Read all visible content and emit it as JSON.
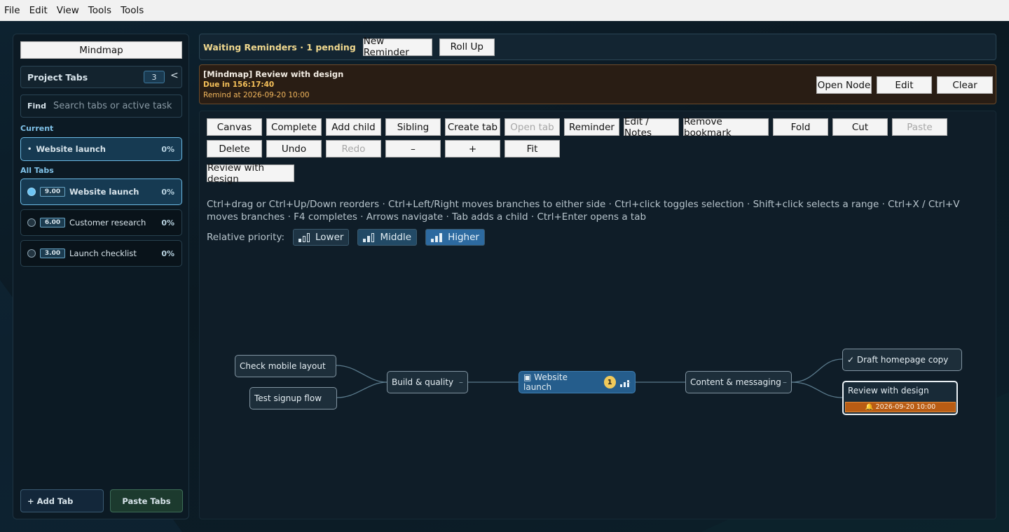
{
  "menubar": [
    "File",
    "Edit",
    "View",
    "Tools",
    "Tools"
  ],
  "sidebar": {
    "mindmap_label": "Mindmap",
    "project_tabs_label": "Project Tabs",
    "project_count": "3",
    "collapse_label": "<",
    "find_label": "Find",
    "find_placeholder": "Search tabs or active task",
    "current_label": "Current",
    "current_item": {
      "label": "Website launch",
      "pct": "0%"
    },
    "all_tabs_label": "All Tabs",
    "tabs": [
      {
        "priority": "9.00",
        "label": "Website launch",
        "pct": "0%"
      },
      {
        "priority": "6.00",
        "label": "Customer research",
        "pct": "0%"
      },
      {
        "priority": "3.00",
        "label": "Launch checklist",
        "pct": "0%"
      }
    ],
    "add_tab_label": "+ Add Tab",
    "paste_tabs_label": "Paste Tabs"
  },
  "reminders": {
    "title": "Waiting Reminders · 1 pending",
    "new_label": "New Reminder",
    "rollup_label": "Roll Up",
    "card": {
      "title": "[Mindmap] Review with design",
      "due": "Due in 156:17:40",
      "remind_at": "Remind at 2026-09-20 10:00",
      "open_label": "Open Node",
      "edit_label": "Edit",
      "clear_label": "Clear"
    }
  },
  "toolbar": {
    "canvas": "Canvas",
    "complete": "Complete",
    "add_child": "Add child",
    "sibling": "Sibling",
    "create_tab": "Create tab",
    "open_tab": "Open tab",
    "reminder": "Reminder",
    "edit_notes": "Edit / Notes",
    "remove_bookmark": "Remove bookmark",
    "fold": "Fold",
    "cut": "Cut",
    "paste": "Paste",
    "delete": "Delete",
    "undo": "Undo",
    "redo": "Redo",
    "zoom_out": "–",
    "zoom_in": "+",
    "fit": "Fit",
    "review": "Review with design"
  },
  "help_text": "Ctrl+drag or Ctrl+Up/Down reorders · Ctrl+Left/Right moves branches to either side · Ctrl+click toggles selection · Shift+click selects a range · Ctrl+X / Ctrl+V moves branches · F4 completes · Arrows navigate · Tab adds a child · Ctrl+Enter opens a tab",
  "priority": {
    "label": "Relative priority:",
    "lower": "Lower",
    "middle": "Middle",
    "higher": "Higher"
  },
  "mindmap": {
    "root": {
      "label": "▣ Website launch",
      "badge": "1"
    },
    "build": "Build & quality",
    "mobile": "Check mobile layout",
    "signup": "Test signup flow",
    "content": "Content & messaging",
    "draft": "✓ Draft homepage copy",
    "review": {
      "label": "Review with design",
      "reminder": "🔔 2026-09-20 10:00"
    },
    "fold_glyph": "–"
  },
  "colors": {
    "accent": "#2d6aa0",
    "reminder": "#b85c14",
    "due": "#f6c15a"
  }
}
